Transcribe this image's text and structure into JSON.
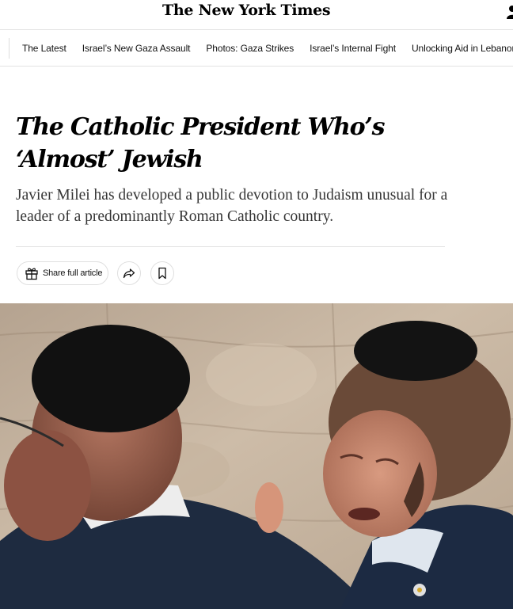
{
  "masthead": {
    "logo_text": "The New York Times",
    "account_icon": "person-icon"
  },
  "nav": {
    "items": [
      {
        "label": "The Latest"
      },
      {
        "label": "Israel’s New Gaza Assault"
      },
      {
        "label": "Photos: Gaza Strikes"
      },
      {
        "label": "Israel’s Internal Fight"
      },
      {
        "label": "Unlocking Aid in Lebanon"
      }
    ]
  },
  "article": {
    "headline": "The Catholic President Who’s ‘Almost’ Jewish",
    "summary": "Javier Milei has developed a public devotion to Judaism unusual for a leader of a predominantly Roman Catholic country.",
    "share_label": "Share full article",
    "share_icon": "gift-icon",
    "forward_icon": "share-arrow-icon",
    "save_icon": "bookmark-icon"
  },
  "colors": {
    "text": "#121212",
    "summary": "#363636",
    "divider": "#e2e2e2"
  }
}
